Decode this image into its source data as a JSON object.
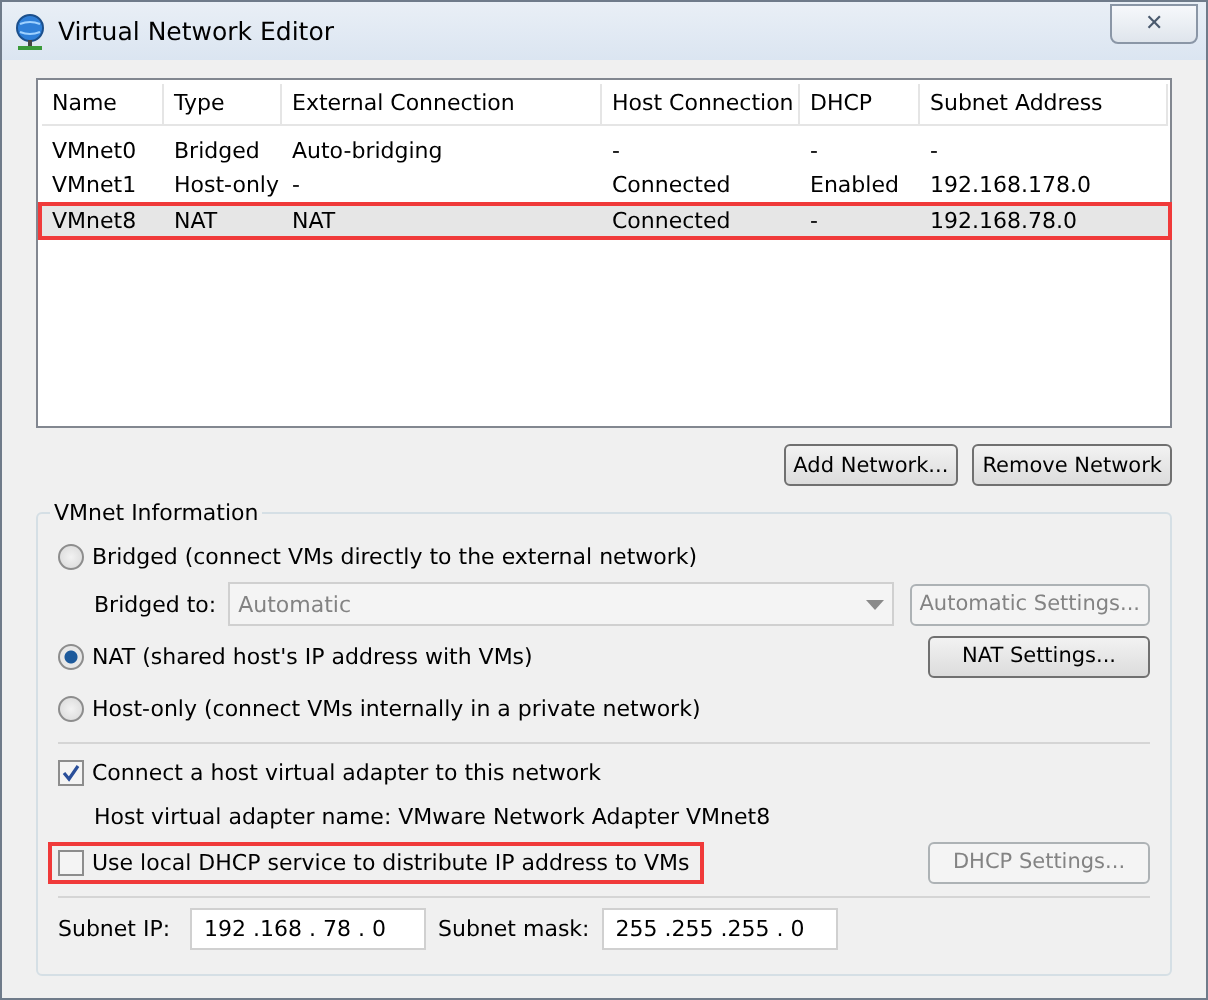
{
  "window": {
    "title": "Virtual Network Editor",
    "close": "✕"
  },
  "table": {
    "columns": [
      "Name",
      "Type",
      "External Connection",
      "Host Connection",
      "DHCP",
      "Subnet Address"
    ],
    "rows": [
      {
        "cells": [
          "VMnet0",
          "Bridged",
          "Auto-bridging",
          "-",
          "-",
          "-"
        ],
        "selected": false,
        "outlined": false
      },
      {
        "cells": [
          "VMnet1",
          "Host-only",
          "-",
          "Connected",
          "Enabled",
          "192.168.178.0"
        ],
        "selected": false,
        "outlined": false
      },
      {
        "cells": [
          "VMnet8",
          "NAT",
          "NAT",
          "Connected",
          "-",
          "192.168.78.0"
        ],
        "selected": true,
        "outlined": true
      }
    ]
  },
  "list_buttons": [
    "Add Network...",
    "Remove Network"
  ],
  "vmnet_info": {
    "title": "VMnet Information",
    "modes": [
      {
        "label": "Bridged (connect VMs directly to the external network)",
        "selected": false
      },
      {
        "label": "NAT (shared host's IP address with VMs)",
        "selected": true
      },
      {
        "label": "Host-only (connect VMs internally in a private network)",
        "selected": false
      }
    ],
    "bridged_to": {
      "label": "Bridged to:",
      "value": "Automatic",
      "disabled": true
    },
    "automatic_settings": {
      "label": "Automatic Settings...",
      "disabled": true
    },
    "nat_settings": {
      "label": "NAT Settings...",
      "disabled": false
    },
    "connect_adapter": {
      "label": "Connect a host virtual adapter to this network",
      "checked": true
    },
    "adapter_name": "Host virtual adapter name: VMware Network Adapter VMnet8",
    "use_dhcp": {
      "label": "Use local DHCP service to distribute IP address to VMs",
      "checked": false,
      "outlined": true
    },
    "dhcp_settings": {
      "label": "DHCP Settings...",
      "disabled": true
    },
    "subnet_ip": {
      "label": "Subnet IP:",
      "value": "192 .168 . 78 . 0"
    },
    "subnet_mask": {
      "label": "Subnet mask:",
      "value": "255 .255 .255 . 0"
    }
  }
}
